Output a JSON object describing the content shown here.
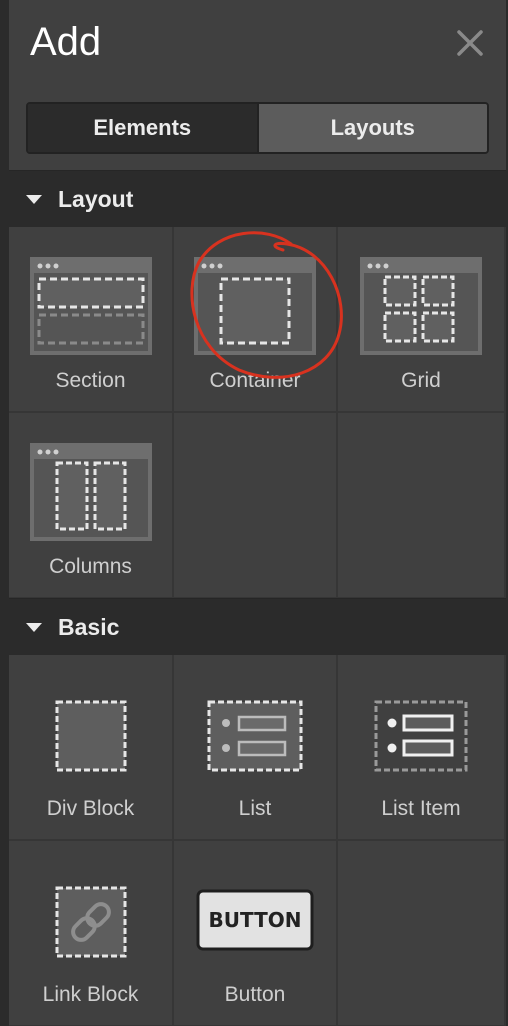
{
  "panel": {
    "title": "Add",
    "close_icon": "close-icon"
  },
  "tabs": [
    {
      "label": "Elements",
      "active": true
    },
    {
      "label": "Layouts",
      "active": false
    }
  ],
  "sections": {
    "layout": {
      "title": "Layout",
      "items": [
        {
          "label": "Section",
          "icon": "section-icon"
        },
        {
          "label": "Container",
          "icon": "container-icon"
        },
        {
          "label": "Grid",
          "icon": "grid-icon"
        },
        {
          "label": "Columns",
          "icon": "columns-icon"
        }
      ]
    },
    "basic": {
      "title": "Basic",
      "items": [
        {
          "label": "Div Block",
          "icon": "div-block-icon"
        },
        {
          "label": "List",
          "icon": "list-icon"
        },
        {
          "label": "List Item",
          "icon": "list-item-icon"
        },
        {
          "label": "Link Block",
          "icon": "link-icon"
        },
        {
          "label": "Button",
          "icon": "button-icon",
          "icon_text": "BUTTON"
        }
      ]
    }
  },
  "colors": {
    "panel_bg": "#404040",
    "section_header_bg": "#2b2b2b",
    "text": "#ececec",
    "annotation": "#d8321f"
  }
}
